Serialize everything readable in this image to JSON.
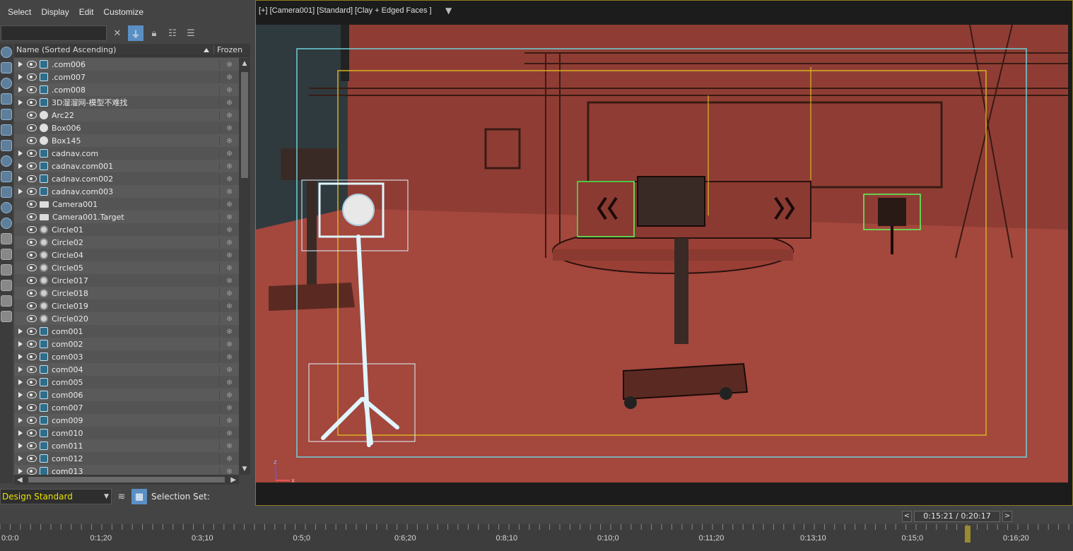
{
  "menu": [
    "Select",
    "Display",
    "Edit",
    "Customize"
  ],
  "search": {
    "value": "",
    "placeholder": ""
  },
  "columns": {
    "name": "Name (Sorted Ascending)",
    "frozen": "Frozen"
  },
  "rows": [
    {
      "name": ".com006",
      "type": "geom",
      "expand": true
    },
    {
      "name": ".com007",
      "type": "geom",
      "expand": true
    },
    {
      "name": ".com008",
      "type": "geom",
      "expand": true
    },
    {
      "name": "3D溜溜网-模型不难找",
      "type": "geom",
      "expand": true
    },
    {
      "name": "Arc22",
      "type": "shape",
      "expand": false
    },
    {
      "name": "Box006",
      "type": "shape",
      "expand": false
    },
    {
      "name": "Box145",
      "type": "shape",
      "expand": false
    },
    {
      "name": "cadnav.com",
      "type": "geom",
      "expand": true
    },
    {
      "name": "cadnav.com001",
      "type": "geom",
      "expand": true
    },
    {
      "name": "cadnav.com002",
      "type": "geom",
      "expand": true
    },
    {
      "name": "cadnav.com003",
      "type": "geom",
      "expand": true
    },
    {
      "name": "Camera001",
      "type": "camera",
      "expand": false
    },
    {
      "name": "Camera001.Target",
      "type": "camera",
      "expand": false
    },
    {
      "name": "Circle01",
      "type": "circle",
      "expand": false
    },
    {
      "name": "Circle02",
      "type": "circle",
      "expand": false
    },
    {
      "name": "Circle04",
      "type": "circle",
      "expand": false
    },
    {
      "name": "Circle05",
      "type": "circle",
      "expand": false
    },
    {
      "name": "Circle017",
      "type": "circle",
      "expand": false
    },
    {
      "name": "Circle018",
      "type": "circle",
      "expand": false
    },
    {
      "name": "Circle019",
      "type": "circle",
      "expand": false
    },
    {
      "name": "Circle020",
      "type": "circle",
      "expand": false
    },
    {
      "name": "com001",
      "type": "geom",
      "expand": true
    },
    {
      "name": "com002",
      "type": "geom",
      "expand": true
    },
    {
      "name": "com003",
      "type": "geom",
      "expand": true
    },
    {
      "name": "com004",
      "type": "geom",
      "expand": true
    },
    {
      "name": "com005",
      "type": "geom",
      "expand": true
    },
    {
      "name": "com006",
      "type": "geom",
      "expand": true
    },
    {
      "name": "com007",
      "type": "geom",
      "expand": true
    },
    {
      "name": "com009",
      "type": "geom",
      "expand": true
    },
    {
      "name": "com010",
      "type": "geom",
      "expand": true
    },
    {
      "name": "com011",
      "type": "geom",
      "expand": true
    },
    {
      "name": "com012",
      "type": "geom",
      "expand": true
    },
    {
      "name": "com013",
      "type": "geom",
      "expand": true
    }
  ],
  "layer_dropdown": "Design Standard",
  "selection_set_label": "Selection Set:",
  "viewport": {
    "label": "[+] [Camera001] [Standard] [Clay + Edged Faces ]",
    "axis_z": "z",
    "axis_x": "x"
  },
  "time": {
    "display": "0:15:21 / 0:20:17",
    "prev": "<",
    "next": ">",
    "playhead_fraction": 0.757,
    "labels": [
      "0:0:0",
      "0:1;20",
      "0:3;10",
      "0:5;0",
      "0:6;20",
      "0:8;10",
      "0:10;0",
      "0:11;20",
      "0:13;10",
      "0:15;0",
      "0:16;20"
    ]
  },
  "colors": {
    "accent": "#5a8fc4",
    "layer_text": "#e8e000",
    "clay": "#a4473d",
    "safe_frame_cyan": "#6fd0d8",
    "safe_frame_yellow": "#d8b020",
    "selection": "#dff6ff"
  }
}
